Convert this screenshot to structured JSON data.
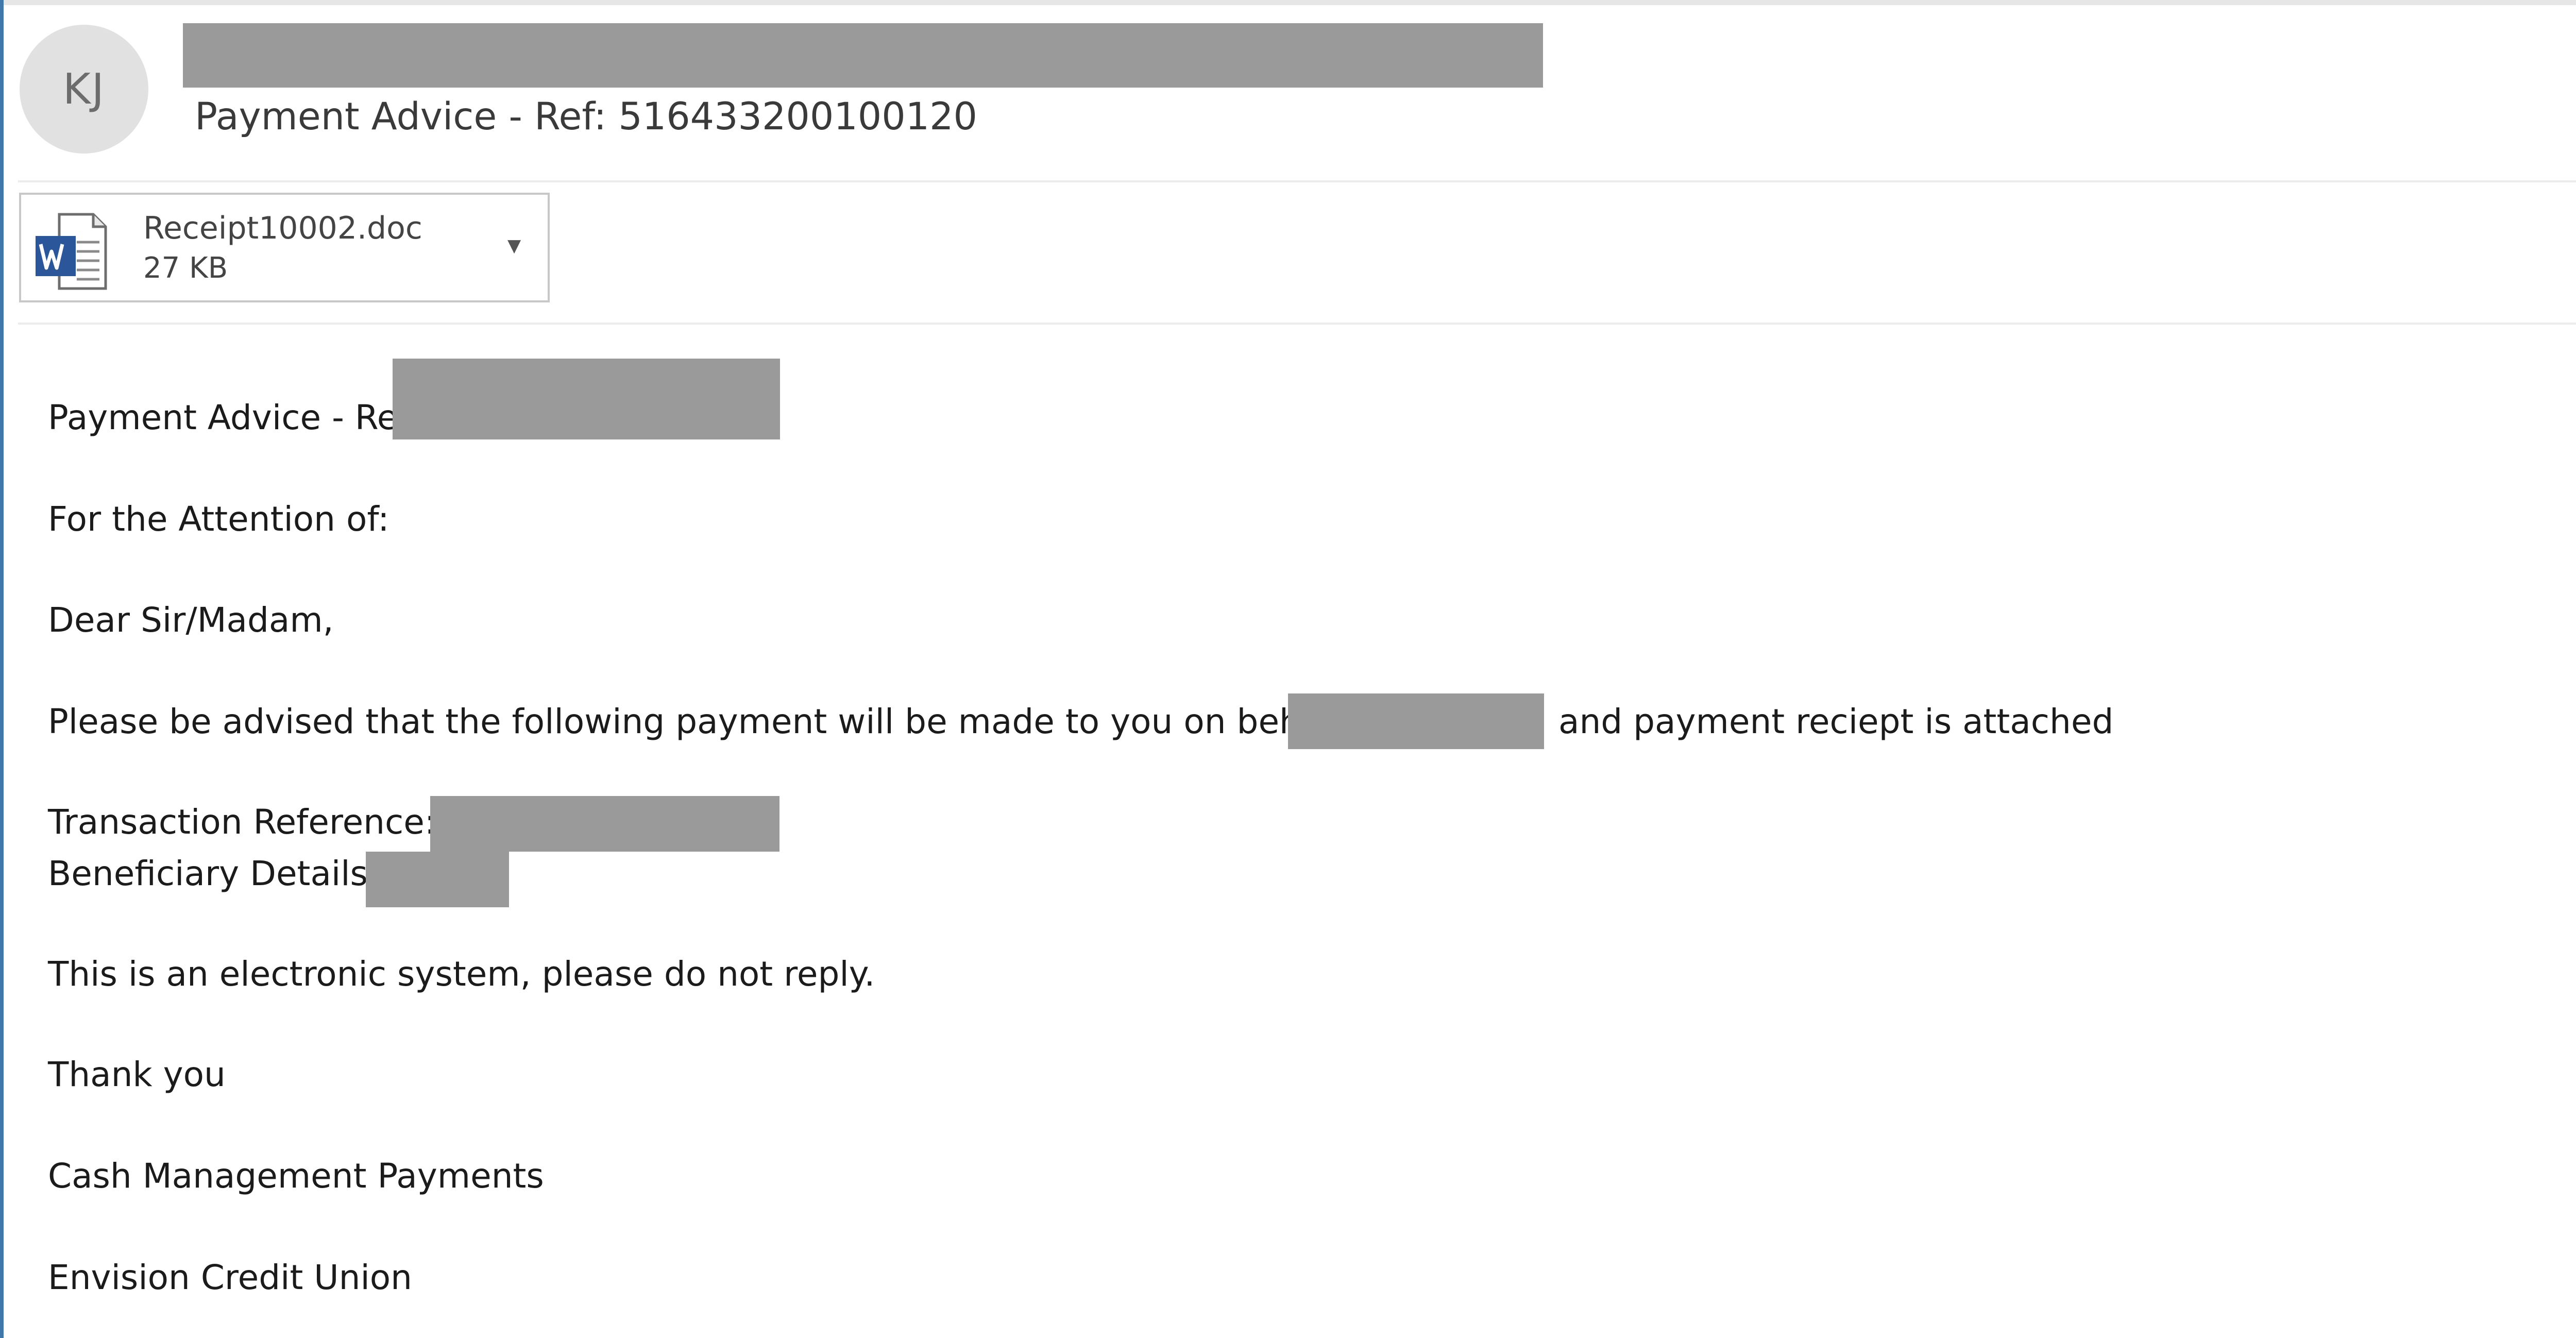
{
  "header": {
    "avatar_initials": "KJ",
    "subject": "Payment Advice - Ref: 516433200100120"
  },
  "attachment": {
    "file_name": "Receipt10002.doc",
    "file_size": "27 KB",
    "icon": "word-document-icon",
    "dropdown_icon": "chevron-down-icon"
  },
  "message": {
    "ref_line": "Payment Advice - Ref:",
    "attention_line": "For the Attention of:",
    "greeting": "Dear Sir/Madam,",
    "advice_line_start": "Please be advised that the following payment will be made to you on behalf of",
    "advice_line_end": "and payment reciept is attached",
    "transaction_reference_label": "Transaction Reference:",
    "beneficiary_details_label": "Beneficiary Details:",
    "notice": "This is an electronic system, please do not reply.",
    "closing": "Thank you",
    "signature_department": "Cash Management Payments",
    "signature_organization": "Envision Credit Union"
  },
  "colors": {
    "redaction": "#9a9a9a",
    "accent_edge": "#3f78ab",
    "word_blue": "#2b579a"
  }
}
